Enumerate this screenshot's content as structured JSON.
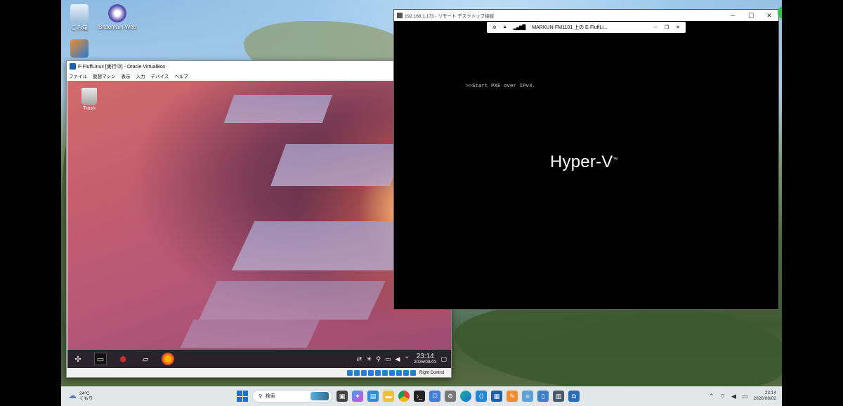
{
  "desktop": {
    "icons": [
      {
        "label": "ごみ箱",
        "icon": "recycle-bin-icon"
      },
      {
        "label": "Bitdomain Web",
        "icon": "browser-app-icon"
      },
      {
        "label": "",
        "icon": "virtualbox-shortcut-icon"
      }
    ]
  },
  "vbox": {
    "title": "F-FluffLinux [実行中] - Oracle VirtualBox",
    "menu": [
      "ファイル",
      "仮想マシン",
      "表示",
      "入力",
      "デバイス",
      "ヘルプ"
    ],
    "guest": {
      "trash_label": "Trash",
      "panel_time": "23:14",
      "panel_date": "2026/08/02"
    },
    "status_host_key": "Right Control"
  },
  "rdp": {
    "title": "192.168.1.173 - リモート デスクトップ接続",
    "connection_name": "MARKUN-FM1101 上の E-FluffLi...",
    "console_line": ">>Start PXE over IPv4.",
    "logo": "Hyper-V",
    "logo_tm": "™"
  },
  "taskbar": {
    "weather_temp": "24°C",
    "weather_desc": "くもり",
    "search_placeholder": "検索",
    "time": "23:14",
    "date": "2026/08/02"
  },
  "colors": {
    "taskbar_bg": "#e8ecf0",
    "win_accent": "#1a73d9",
    "guest_panel": "#1e1e26"
  }
}
